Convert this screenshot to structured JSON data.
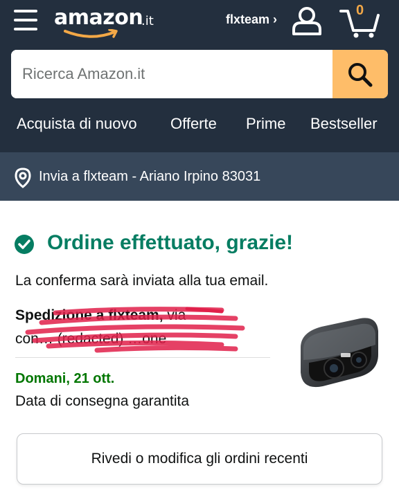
{
  "header": {
    "logo_text": "amazon",
    "logo_tld": ".it",
    "account_label": "flxteam ›",
    "cart_count": "0",
    "search_placeholder": "Ricerca Amazon.it",
    "nav": [
      "Acquista di nuovo",
      "Offerte",
      "Prime",
      "Bestseller"
    ]
  },
  "delivery_bar": {
    "text": "Invia a flxteam - Ariano Irpino 83031",
    "icon": "location-pin-icon"
  },
  "order": {
    "title": "Ordine effettuato, grazie!",
    "confirmation": "La conferma sarà inviata alla tua email.",
    "shipping_bold": "Spedizione a flxteam,",
    "shipping_rest": " via",
    "shipping_line2": "con… (redacted) …one",
    "delivery_date": "Domani, 21 ott.",
    "delivery_note": "Data di consegna garantita",
    "review_button": "Rivedi o modifica gli ordini recenti"
  },
  "colors": {
    "header_bg": "#232f3e",
    "deliver_bg": "#37475a",
    "search_button": "#febd69",
    "success_green": "#067d62",
    "date_green": "#007600",
    "cart_orange": "#f3a847",
    "scribble_red": "#e0204a"
  }
}
